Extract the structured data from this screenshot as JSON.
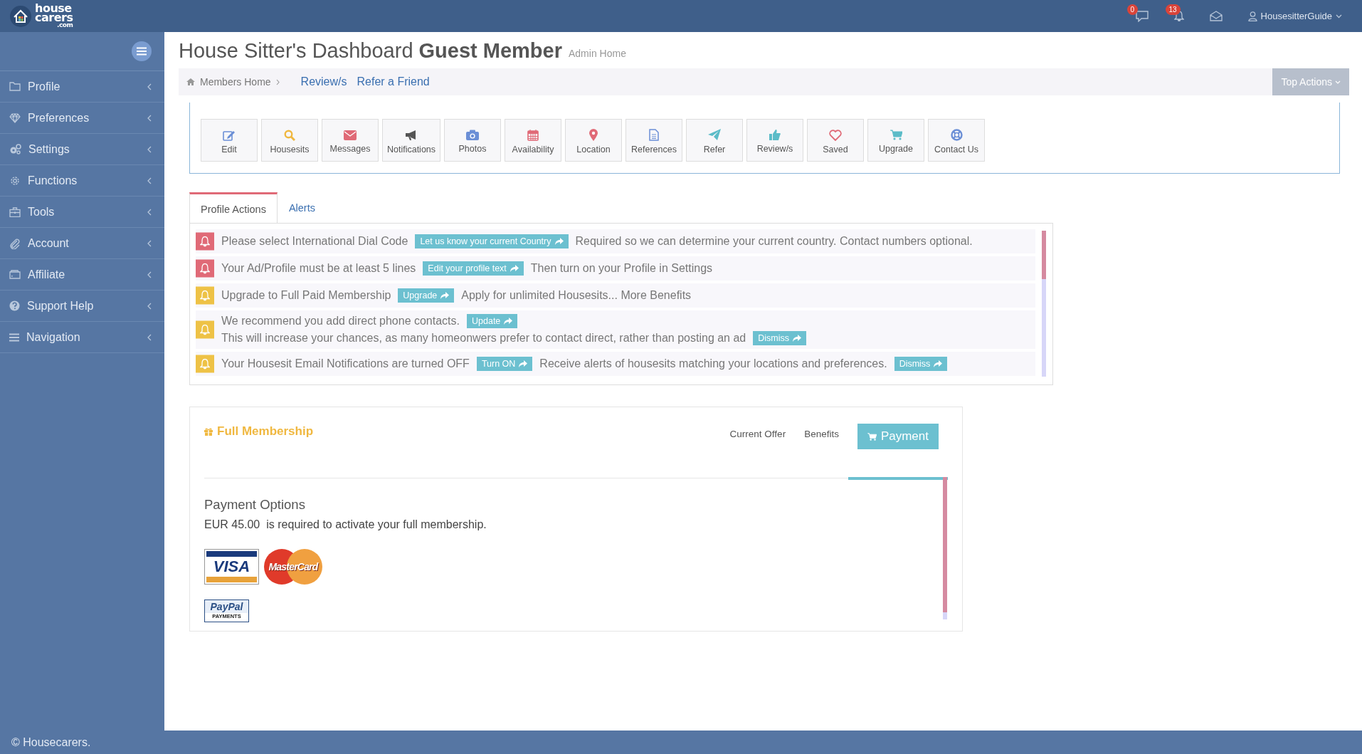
{
  "logo": {
    "line_1": "house",
    "line_2": "carers",
    "line_3": ".com"
  },
  "topbar": {
    "message_count": "0",
    "notification_count": "13",
    "user": "HousesitterGuide"
  },
  "sidebar": {
    "items": [
      {
        "label": "Profile"
      },
      {
        "label": "Preferences"
      },
      {
        "label": "Settings"
      },
      {
        "label": "Functions"
      },
      {
        "label": "Tools"
      },
      {
        "label": "Account"
      },
      {
        "label": "Affiliate"
      },
      {
        "label": "Support Help"
      },
      {
        "label": "Navigation"
      }
    ]
  },
  "page_header": {
    "title": "House Sitter's Dashboard",
    "title_bold": "Guest Member",
    "subtitle": "Admin Home"
  },
  "breadcrumb": {
    "home": "Members Home",
    "links": [
      "Review/s",
      "Refer a Friend"
    ],
    "top_actions": "Top Actions"
  },
  "toolbar": [
    "Edit",
    "Housesits",
    "Messages",
    "Notifications",
    "Photos",
    "Availability",
    "Location",
    "References",
    "Refer",
    "Review/s",
    "Saved",
    "Upgrade",
    "Contact Us"
  ],
  "tabs": [
    {
      "label": "Profile Actions",
      "selected": true
    },
    {
      "label": "Alerts",
      "selected": false
    }
  ],
  "alerts": [
    {
      "color": "#e06a77",
      "parts": [
        {
          "kind": "text",
          "text": "Please select International Dial Code"
        },
        {
          "kind": "button",
          "text": "Let us know your current Country"
        },
        {
          "kind": "text",
          "text": "Required so we can determine your current country. Contact numbers optional."
        }
      ]
    },
    {
      "color": "#e06a77",
      "parts": [
        {
          "kind": "text",
          "text": "Your Ad/Profile must be at least 5 lines"
        },
        {
          "kind": "button",
          "text": "Edit your profile text"
        },
        {
          "kind": "text",
          "text": "Then turn on your Profile in Settings"
        }
      ]
    },
    {
      "color": "#eec246",
      "parts": [
        {
          "kind": "text",
          "text": "Upgrade to Full Paid Membership"
        },
        {
          "kind": "button",
          "text": "Upgrade"
        },
        {
          "kind": "text",
          "text": "Apply for unlimited Housesits... More Benefits"
        }
      ]
    },
    {
      "color": "#eec246",
      "parts": [
        {
          "kind": "text",
          "text": "We recommend you add direct phone contacts."
        },
        {
          "kind": "button",
          "text": "Update"
        },
        {
          "kind": "text",
          "text": "This will increase your chances, as many homeonwers prefer to contact direct, rather than posting an ad"
        },
        {
          "kind": "button",
          "text": "Dismiss"
        }
      ]
    },
    {
      "color": "#eec246",
      "parts": [
        {
          "kind": "text",
          "text": "Your Housesit Email Notifications are turned OFF"
        },
        {
          "kind": "button",
          "text": "Turn ON"
        },
        {
          "kind": "text",
          "text": "Receive alerts of housesits matching your locations and preferences."
        },
        {
          "kind": "button",
          "text": "Dismiss"
        }
      ]
    }
  ],
  "membership": {
    "title": "Full Membership",
    "tabs": [
      {
        "label": "Current Offer",
        "selected": false
      },
      {
        "label": "Benefits",
        "selected": false
      },
      {
        "label": "Payment",
        "selected": true
      }
    ],
    "heading": "Payment Options",
    "amount": "EUR 45.00",
    "note": "is required to activate your full membership.",
    "cards": {
      "visa": "VISA",
      "mastercard": "MasterCard",
      "paypal": "PayPal",
      "paypal_sub": "PAYMENTS"
    }
  },
  "footer": "© Housecarers."
}
